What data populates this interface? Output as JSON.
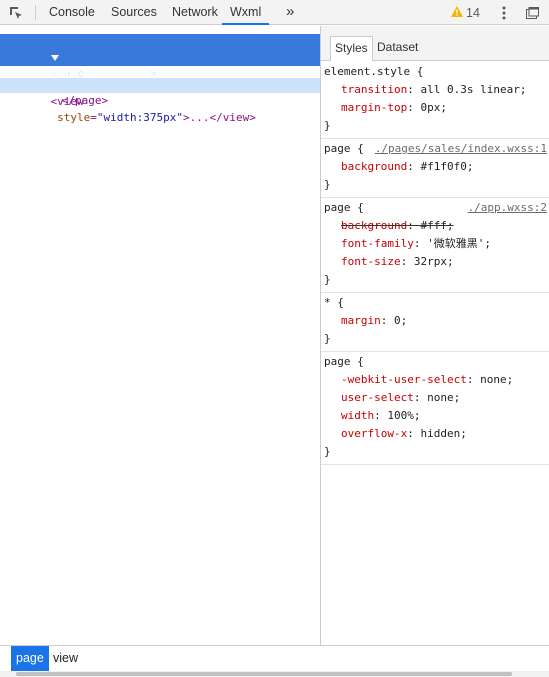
{
  "toolbar": {
    "tabs": [
      {
        "label": "Console"
      },
      {
        "label": "Sources"
      },
      {
        "label": "Network"
      },
      {
        "label": "Wxml"
      }
    ],
    "more": "»",
    "warning_count": "14",
    "icons": [
      "inspect-icon",
      "more-tabs-icon",
      "warning-icon",
      "kebab-menu-icon",
      "dock-icon"
    ]
  },
  "dom": {
    "selected_open": "<page",
    "selected_attr_name": "style",
    "selected_attr_value_line1": "\"transition: all 0.3s linear; ma",
    "selected_attr_value_line2": "rgin-top: 0px;\"",
    "selected_close": ">",
    "child_open": "<view",
    "child_attr_name": "style",
    "child_attr_value": "\"width:375px\"",
    "child_rest": ">...</view>",
    "close_tag": "</page>"
  },
  "styles": {
    "tabs": [
      {
        "label": "Styles"
      },
      {
        "label": "Dataset"
      }
    ],
    "rules": [
      {
        "selector": "element.style {",
        "source": "",
        "props": [
          {
            "name": "transition",
            "value": "all 0.3s linear;",
            "struck": false
          },
          {
            "name": "margin-top",
            "value": "0px;",
            "struck": false
          }
        ],
        "close": "}"
      },
      {
        "selector": "page {",
        "source": "./pages/sales/index.wxss:1",
        "props": [
          {
            "name": "background",
            "value": "#f1f0f0;",
            "struck": false
          }
        ],
        "close": "}"
      },
      {
        "selector": "page {",
        "source": "./app.wxss:2",
        "props": [
          {
            "name": "background",
            "value": "#fff;",
            "struck": true
          },
          {
            "name": "font-family",
            "value": "'微软雅黑';",
            "struck": false
          },
          {
            "name": "font-size",
            "value": "32rpx;",
            "struck": false
          }
        ],
        "close": "}"
      },
      {
        "selector": "* {",
        "source": "",
        "props": [
          {
            "name": "margin",
            "value": "0;",
            "struck": false
          }
        ],
        "close": "}"
      },
      {
        "selector": "page {",
        "source": "",
        "props": [
          {
            "name": "-webkit-user-select",
            "value": "none;",
            "struck": false
          },
          {
            "name": "user-select",
            "value": "none;",
            "struck": false
          },
          {
            "name": "width",
            "value": "100%;",
            "struck": false
          },
          {
            "name": "overflow-x",
            "value": "hidden;",
            "struck": false
          }
        ],
        "close": "}"
      }
    ]
  },
  "breadcrumb": [
    {
      "label": "page",
      "active": true
    },
    {
      "label": "view",
      "active": false
    }
  ],
  "colors": {
    "accent": "#1a73e8",
    "selected_row": "#3879d9",
    "hover_row": "#cfe2fb",
    "warning": "#f4b400"
  }
}
